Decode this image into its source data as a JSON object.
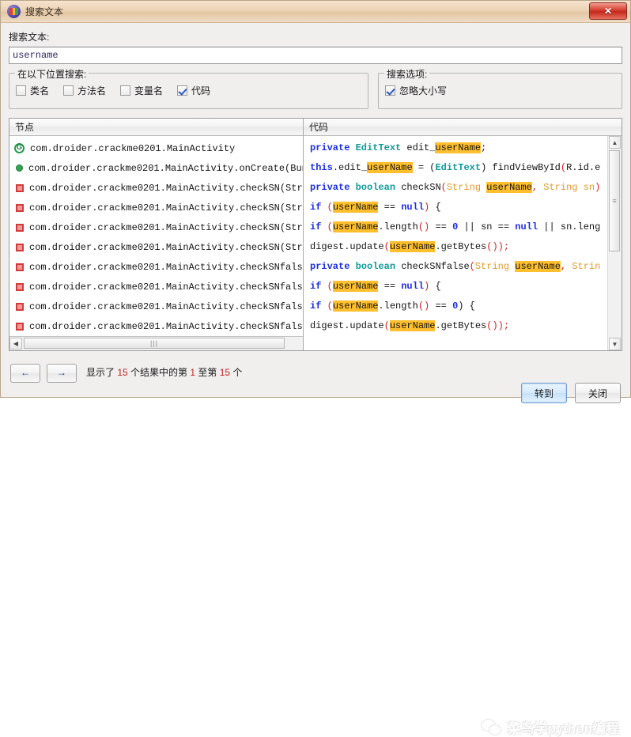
{
  "window": {
    "title": "搜索文本",
    "icon": "app-icon",
    "close_label": "✕"
  },
  "search": {
    "label": "搜索文本:",
    "value": "username",
    "placeholder": ""
  },
  "locations_group": {
    "title": "在以下位置搜索:",
    "items": [
      {
        "label": "类名",
        "checked": false
      },
      {
        "label": "方法名",
        "checked": false
      },
      {
        "label": "变量名",
        "checked": false
      },
      {
        "label": "代码",
        "checked": true
      }
    ]
  },
  "options_group": {
    "title": "搜索选项:",
    "items": [
      {
        "label": "忽略大小写",
        "checked": true
      }
    ]
  },
  "results": {
    "tree_header": "节点",
    "code_header": "代码",
    "rows": [
      {
        "icon": "class-icon",
        "label": "com.droider.crackme0201.MainActivity"
      },
      {
        "icon": "public-method-icon",
        "label": "com.droider.crackme0201.MainActivity.onCreate(Bund"
      },
      {
        "icon": "private-method-icon",
        "label": "com.droider.crackme0201.MainActivity.checkSN(Strin"
      },
      {
        "icon": "private-method-icon",
        "label": "com.droider.crackme0201.MainActivity.checkSN(Strin"
      },
      {
        "icon": "private-method-icon",
        "label": "com.droider.crackme0201.MainActivity.checkSN(Strin"
      },
      {
        "icon": "private-method-icon",
        "label": "com.droider.crackme0201.MainActivity.checkSN(Strin"
      },
      {
        "icon": "private-method-icon",
        "label": "com.droider.crackme0201.MainActivity.checkSNfalse("
      },
      {
        "icon": "private-method-icon",
        "label": "com.droider.crackme0201.MainActivity.checkSNfalse("
      },
      {
        "icon": "private-method-icon",
        "label": "com.droider.crackme0201.MainActivity.checkSNfalse("
      },
      {
        "icon": "private-method-icon",
        "label": "com.droider.crackme0201.MainActivity.checkSNfalse("
      }
    ],
    "code_lines": [
      [
        {
          "t": "private ",
          "c": "kw"
        },
        {
          "t": "EditText",
          "c": "typ"
        },
        {
          "t": " edit_",
          "c": "txt"
        },
        {
          "t": "userName",
          "c": "hl"
        },
        {
          "t": ";",
          "c": "txt"
        }
      ],
      [
        {
          "t": "this",
          "c": "kw"
        },
        {
          "t": ".edit_",
          "c": "txt"
        },
        {
          "t": "userName",
          "c": "hl"
        },
        {
          "t": " = (",
          "c": "txt"
        },
        {
          "t": "EditText",
          "c": "typ"
        },
        {
          "t": ") findViewById",
          "c": "txt"
        },
        {
          "t": "(",
          "c": "pun"
        },
        {
          "t": "R.id.e",
          "c": "txt"
        }
      ],
      [
        {
          "t": "private ",
          "c": "kw"
        },
        {
          "t": "boolean",
          "c": "typ"
        },
        {
          "t": " checkSN",
          "c": "txt"
        },
        {
          "t": "(",
          "c": "pun"
        },
        {
          "t": "String ",
          "c": "str"
        },
        {
          "t": "userName",
          "c": "hl"
        },
        {
          "t": ", ",
          "c": "pun"
        },
        {
          "t": "String sn",
          "c": "str"
        },
        {
          "t": ")",
          "c": "pun"
        }
      ],
      [
        {
          "t": "if ",
          "c": "kw"
        },
        {
          "t": "(",
          "c": "pun"
        },
        {
          "t": "userName",
          "c": "hl"
        },
        {
          "t": " == ",
          "c": "txt"
        },
        {
          "t": "null",
          "c": "kw"
        },
        {
          "t": ")",
          "c": "pun"
        },
        {
          "t": " {",
          "c": "txt"
        }
      ],
      [
        {
          "t": "if ",
          "c": "kw"
        },
        {
          "t": "(",
          "c": "pun"
        },
        {
          "t": "userName",
          "c": "hl"
        },
        {
          "t": ".length",
          "c": "txt"
        },
        {
          "t": "()",
          "c": "pun"
        },
        {
          "t": " == ",
          "c": "txt"
        },
        {
          "t": "0",
          "c": "kw"
        },
        {
          "t": " || sn == ",
          "c": "txt"
        },
        {
          "t": "null",
          "c": "kw"
        },
        {
          "t": " || sn.leng",
          "c": "txt"
        }
      ],
      [
        {
          "t": "digest.update",
          "c": "txt"
        },
        {
          "t": "(",
          "c": "pun"
        },
        {
          "t": "userName",
          "c": "hl"
        },
        {
          "t": ".getBytes",
          "c": "txt"
        },
        {
          "t": "());",
          "c": "pun"
        }
      ],
      [
        {
          "t": "private ",
          "c": "kw"
        },
        {
          "t": "boolean",
          "c": "typ"
        },
        {
          "t": " checkSNfalse",
          "c": "txt"
        },
        {
          "t": "(",
          "c": "pun"
        },
        {
          "t": "String ",
          "c": "str"
        },
        {
          "t": "userName",
          "c": "hl"
        },
        {
          "t": ", ",
          "c": "pun"
        },
        {
          "t": "Strin",
          "c": "str"
        }
      ],
      [
        {
          "t": "if ",
          "c": "kw"
        },
        {
          "t": "(",
          "c": "pun"
        },
        {
          "t": "userName",
          "c": "hl"
        },
        {
          "t": " == ",
          "c": "txt"
        },
        {
          "t": "null",
          "c": "kw"
        },
        {
          "t": ")",
          "c": "pun"
        },
        {
          "t": " {",
          "c": "txt"
        }
      ],
      [
        {
          "t": "if ",
          "c": "kw"
        },
        {
          "t": "(",
          "c": "pun"
        },
        {
          "t": "userName",
          "c": "hl"
        },
        {
          "t": ".length",
          "c": "txt"
        },
        {
          "t": "()",
          "c": "pun"
        },
        {
          "t": " == ",
          "c": "txt"
        },
        {
          "t": "0",
          "c": "kw"
        },
        {
          "t": ") {",
          "c": "txt"
        }
      ],
      [
        {
          "t": "digest.update",
          "c": "txt"
        },
        {
          "t": "(",
          "c": "pun"
        },
        {
          "t": "userName",
          "c": "hl"
        },
        {
          "t": ".getBytes",
          "c": "txt"
        },
        {
          "t": "());",
          "c": "pun"
        }
      ]
    ]
  },
  "footer": {
    "prev_label": "←",
    "next_label": "→",
    "status": {
      "prefix": "显示了 ",
      "total": "15",
      "mid1": " 个结果中的第 ",
      "from": "1",
      "mid2": " 至第 ",
      "to": "15",
      "suffix": " 个"
    },
    "goto_label": "转到",
    "close_label": "关闭"
  },
  "watermark": {
    "text": "菜鸟学python编程",
    "logo": "wechat-logo"
  },
  "colors": {
    "titlebar": "#e8cdae",
    "close_button": "#c3291c",
    "highlight": "#ffbf2e",
    "keyword": "#1a2ee0",
    "type": "#0f9a9a",
    "string": "#e09b2d",
    "punctuation": "#d42020",
    "class_icon": "#229a4a",
    "public_icon": "#33a352",
    "private_icon": "#d43a3a",
    "status_number": "#c02020"
  }
}
